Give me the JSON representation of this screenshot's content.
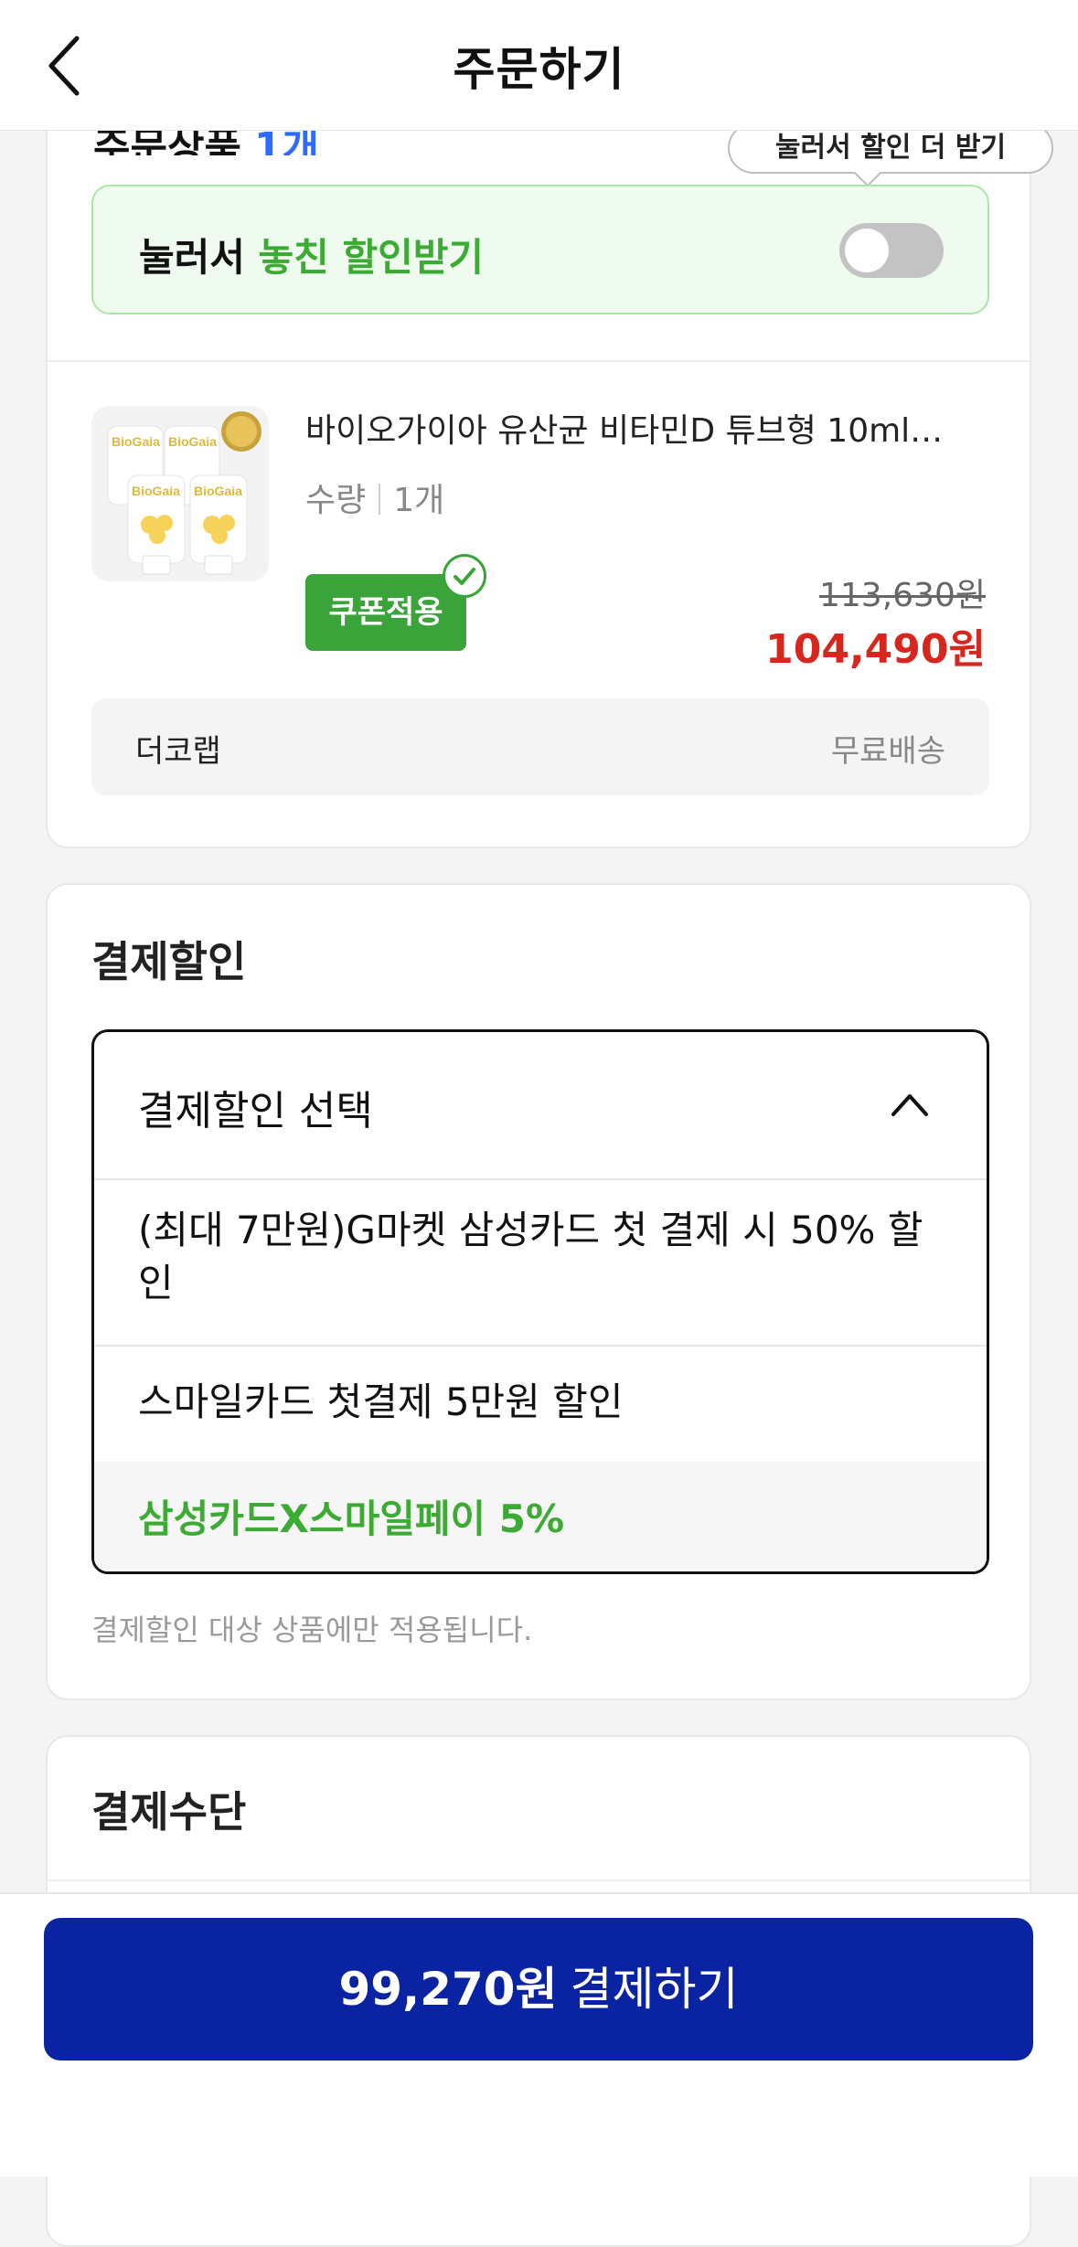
{
  "header": {
    "title": "주문하기",
    "back_icon": "chevron-left-icon"
  },
  "order": {
    "section_title_partial": "주문상품",
    "item_count": "1개",
    "tooltip": "눌러서 할인 더 받기",
    "promo": {
      "text_black": "눌러서 ",
      "text_green": "놓친 할인받기",
      "toggle_on": false
    },
    "product": {
      "name": "바이오가이아 유산균 비타민D 튜브형 10ml…",
      "qty_label": "수량",
      "qty_value": "1개",
      "coupon_label": "쿠폰적용",
      "original_price": "113,630",
      "original_price_unit": "원",
      "sale_price": "104,490원"
    },
    "shipping": {
      "seller": "더코랩",
      "fee": "무료배송"
    }
  },
  "payment_discount": {
    "title": "결제할인",
    "dropdown_label": "결제할인 선택",
    "options": [
      "(최대 7만원)G마켓 삼성카드 첫 결제 시 50% 할인",
      "스마일카드 첫결제 5만원 할인",
      "삼성카드X스마일페이 5%"
    ],
    "note": "결제할인 대상 상품에만 적용됩니다."
  },
  "payment_method": {
    "title": "결제수단"
  },
  "checkout": {
    "amount": "99,270원",
    "label": "결제하기"
  },
  "colors": {
    "accent_green": "#3bab33",
    "price_red": "#d7261d",
    "button_blue": "#0a23a3",
    "link_blue": "#2f6bff"
  }
}
